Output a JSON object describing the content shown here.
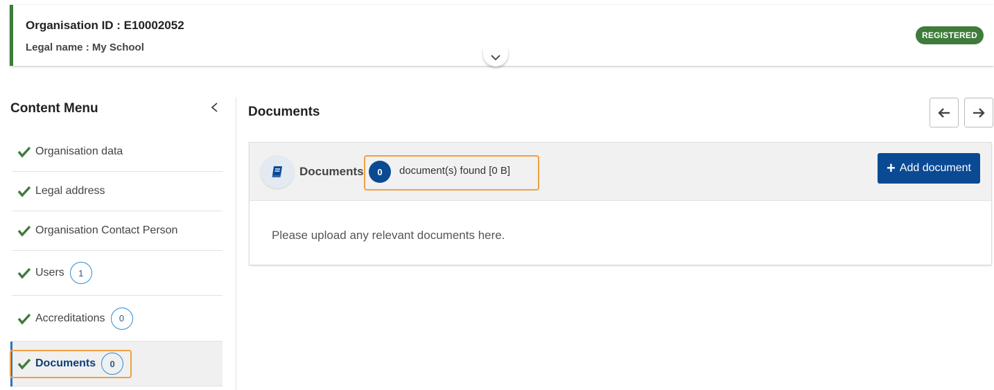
{
  "header": {
    "org_id": "Organisation ID : E10002052",
    "legal_name": "Legal name : My School",
    "status": "REGISTERED",
    "status_color": "#3f7b3a"
  },
  "sidebar": {
    "title": "Content Menu",
    "items": [
      {
        "label": "Organisation data",
        "count": null
      },
      {
        "label": "Legal address",
        "count": null
      },
      {
        "label": "Organisation Contact Person",
        "count": null
      },
      {
        "label": "Users",
        "count": "1"
      },
      {
        "label": "Accreditations",
        "count": "0"
      },
      {
        "label": "Documents",
        "count": "0",
        "active": true
      }
    ]
  },
  "main": {
    "title": "Documents",
    "panel": {
      "title": "Documents",
      "count": "0",
      "found_text": "document(s) found [0 B]",
      "add_button": "Add document",
      "body_text": "Please upload any relevant documents here."
    }
  },
  "colors": {
    "primary": "#0a4a95",
    "success": "#3f7b3a",
    "highlight": "#f0a040"
  }
}
